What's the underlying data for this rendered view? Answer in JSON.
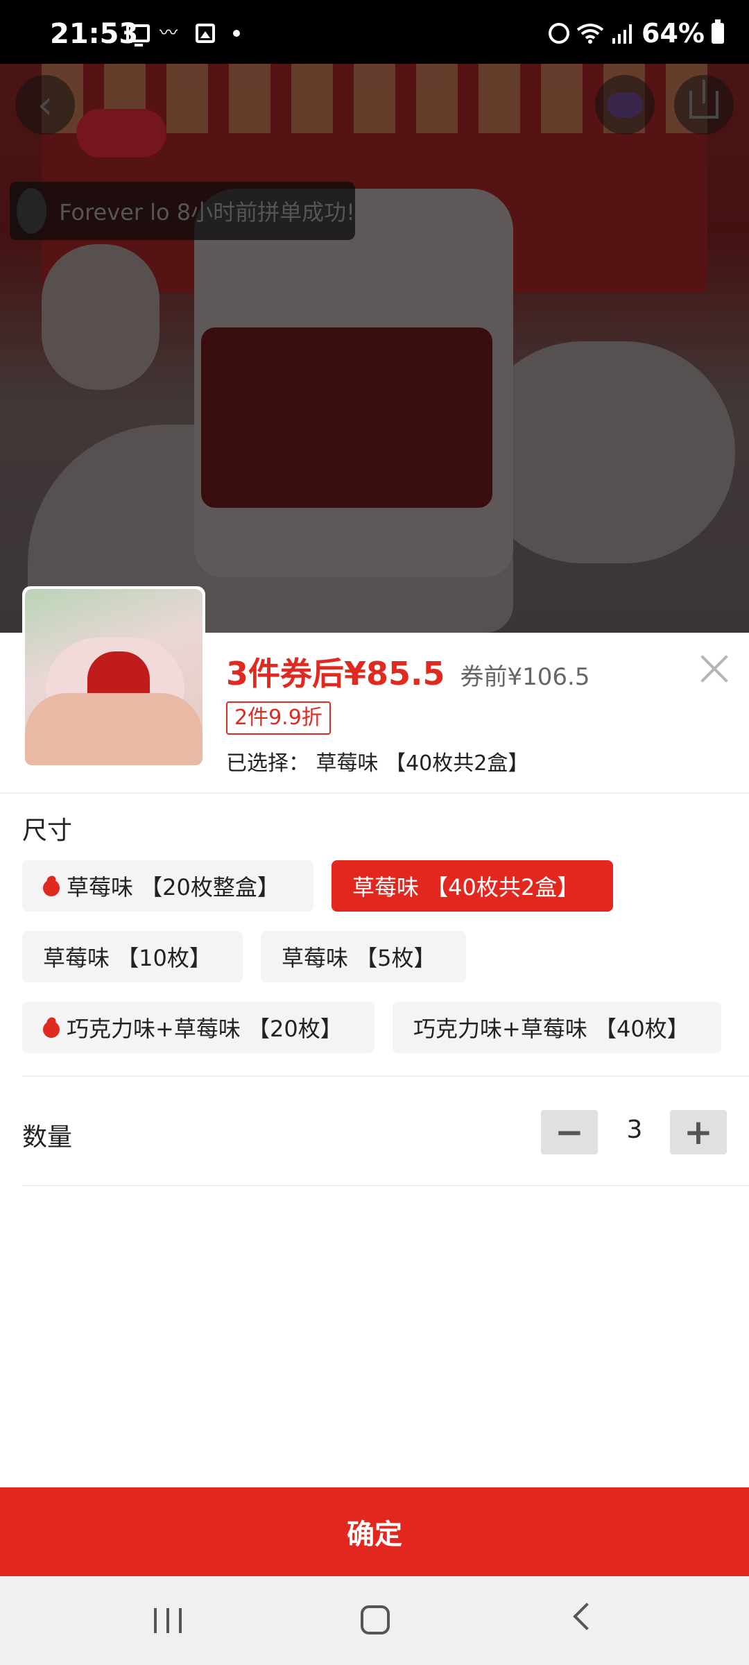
{
  "status_bar": {
    "time": "21:53",
    "battery": "64%",
    "icons_left": [
      "screen-icon",
      "bird-icon",
      "image-icon",
      "dot-icon"
    ],
    "icons_right": [
      "alarm-icon",
      "wifi-icon",
      "signal-icon",
      "battery-icon"
    ]
  },
  "background": {
    "notification": "Forever lo 8小时前拼单成功!"
  },
  "sheet": {
    "price_after_coupon": "3件券后¥85.5",
    "price_before_coupon": "券前¥106.5",
    "discount_tag": "2件9.9折",
    "selected_label": "已选择：",
    "selected_value": "草莓味 【40枚共2盒】",
    "size_title": "尺寸",
    "options": [
      {
        "label": "草莓味 【20枚整盒】",
        "hot": true,
        "selected": false
      },
      {
        "label": "草莓味 【40枚共2盒】",
        "hot": false,
        "selected": true
      },
      {
        "label": "草莓味 【10枚】",
        "hot": false,
        "selected": false
      },
      {
        "label": "草莓味 【5枚】",
        "hot": false,
        "selected": false
      },
      {
        "label": "巧克力味+草莓味 【20枚】",
        "hot": true,
        "selected": false
      },
      {
        "label": "巧克力味+草莓味 【40枚】",
        "hot": false,
        "selected": false
      }
    ],
    "quantity_title": "数量",
    "quantity": "3",
    "minus": "−",
    "plus": "+",
    "confirm": "确定"
  },
  "colors": {
    "accent": "#e2281e",
    "option_bg": "#f4f4f4"
  }
}
